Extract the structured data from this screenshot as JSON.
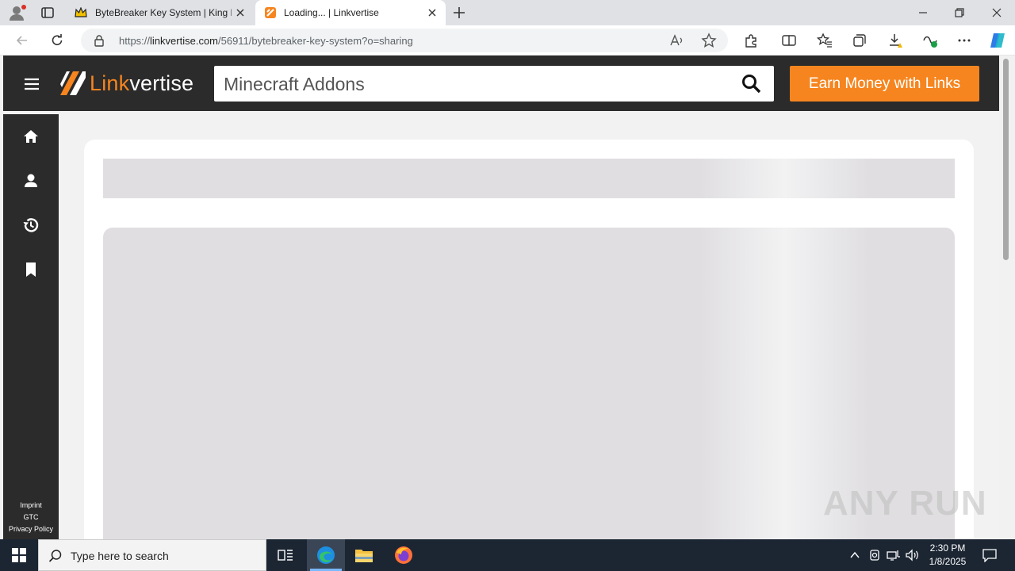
{
  "browser": {
    "tabs": [
      {
        "title": "ByteBreaker Key System | King Ex",
        "active": false
      },
      {
        "title": "Loading... | Linkvertise",
        "active": true
      }
    ],
    "url_prefix": "https://",
    "url_host": "linkvertise.com",
    "url_path": "/56911/bytebreaker-key-system?o=sharing"
  },
  "site": {
    "logo_link": "Link",
    "logo_vertise": "vertise",
    "search_value": "Minecraft Addons",
    "earn_button": "Earn Money with Links",
    "footer_links": [
      "Imprint",
      "GTC",
      "Privacy Policy"
    ],
    "accent_color": "#f6851f"
  },
  "watermark": "ANY RUN",
  "taskbar": {
    "search_placeholder": "Type here to search",
    "time": "2:30 PM",
    "date": "1/8/2025"
  }
}
